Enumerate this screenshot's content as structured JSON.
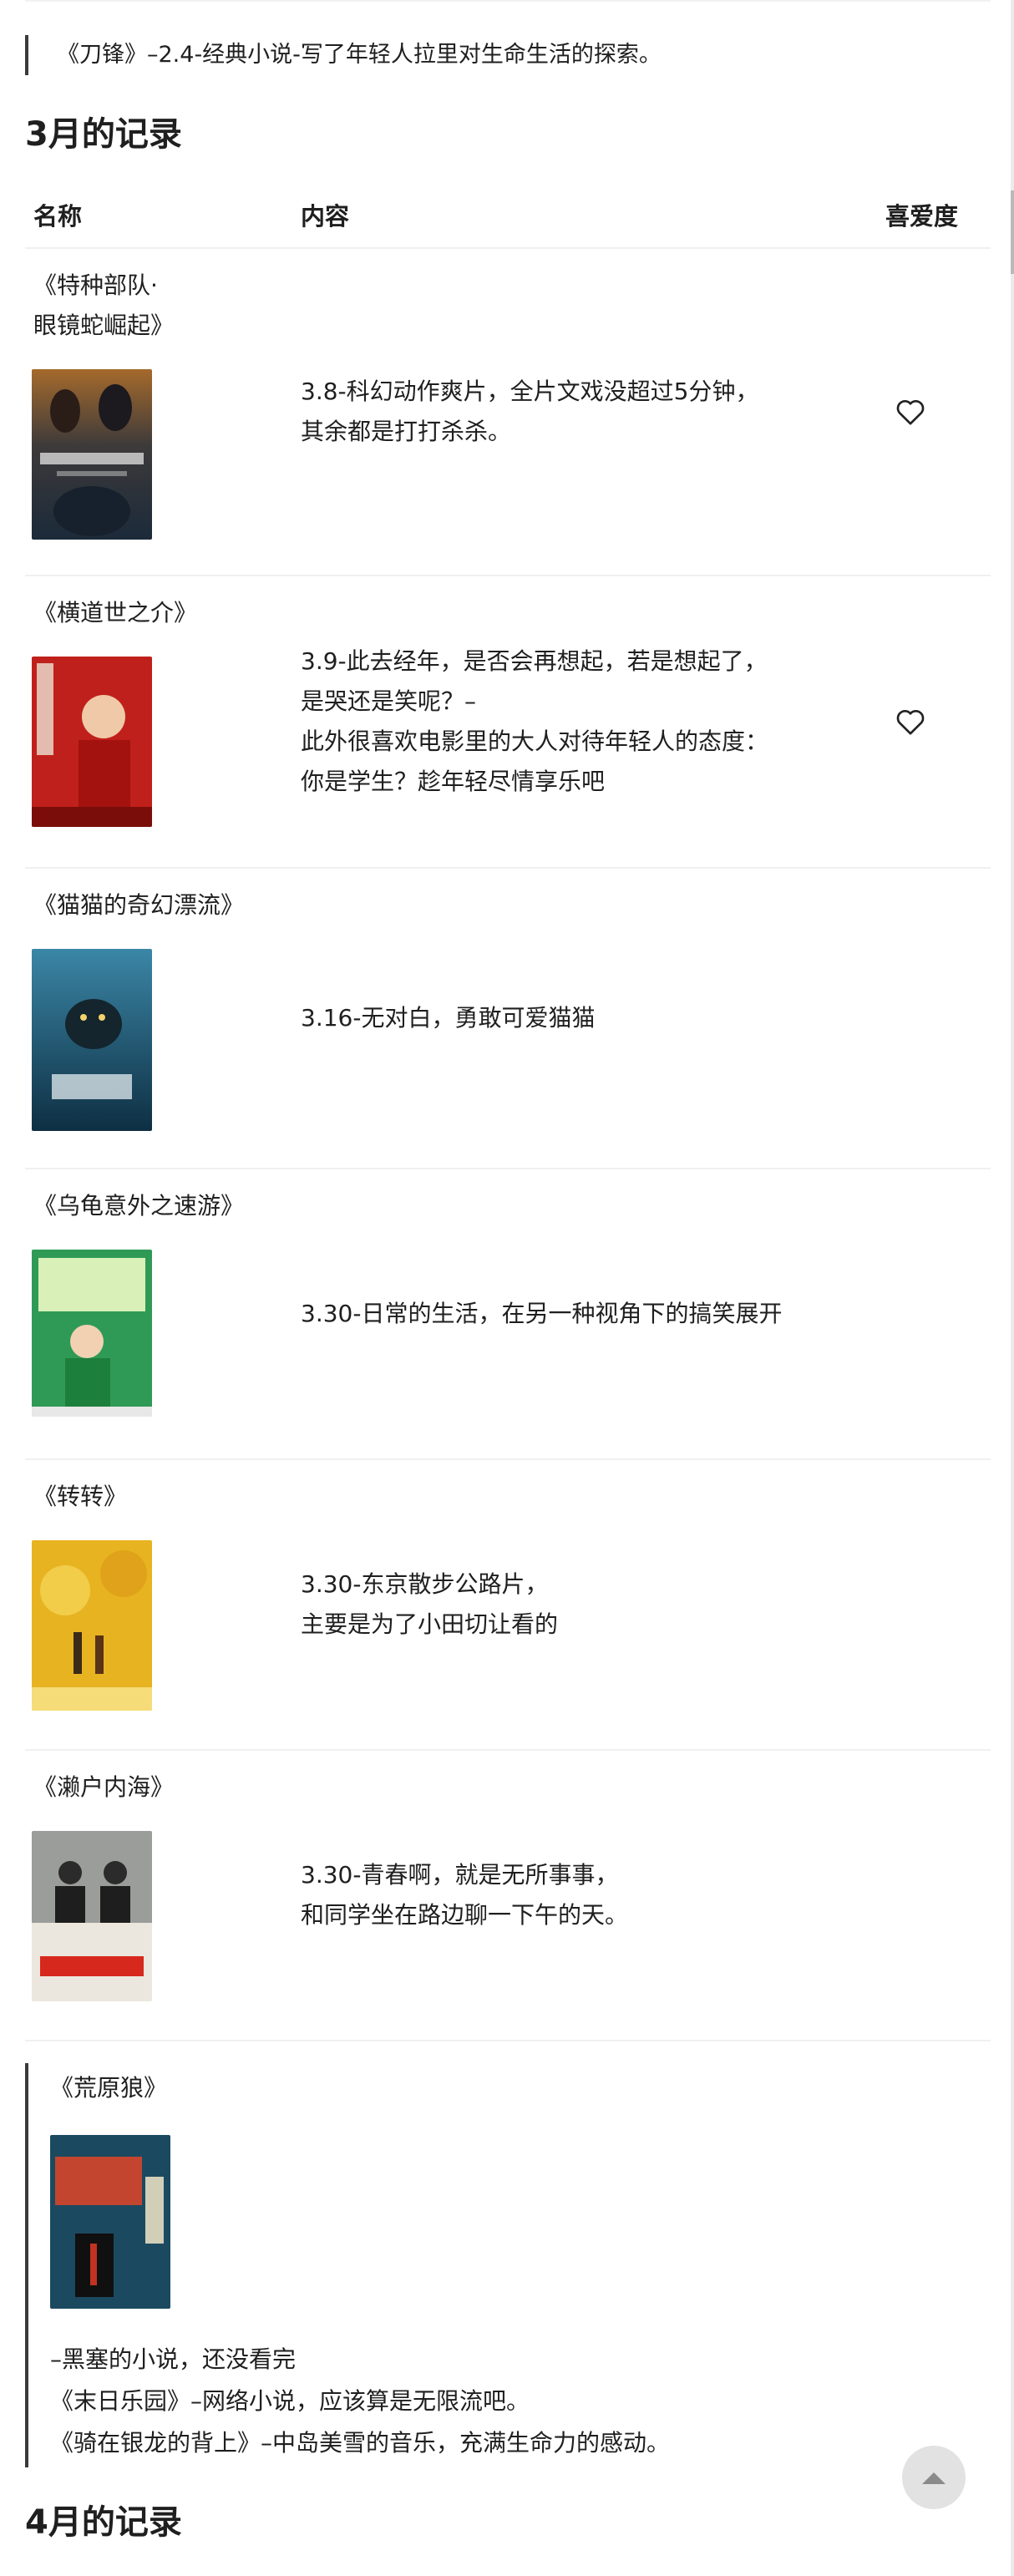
{
  "intro_quote": "《刀锋》–2.4-经典小说-写了年轻人拉里对生命生活的探索。",
  "march": {
    "title": "3月的记录",
    "headers": {
      "name": "名称",
      "content": "内容",
      "love": "喜爱度"
    },
    "rows": [
      {
        "name": "《特种部队·\n眼镜蛇崛起》",
        "content": "3.8-科幻动作爽片，全片文戏没超过5分钟，\n其余都是打打杀杀。",
        "loved": true
      },
      {
        "name": "《横道世之介》",
        "content": "3.9-此去经年，是否会再想起，若是想起了，\n是哭还是笑呢？–\n此外很喜欢电影里的大人对待年轻人的态度：\n你是学生？趁年轻尽情享乐吧",
        "loved": true
      },
      {
        "name": "《猫猫的奇幻漂流》",
        "content": "3.16-无对白，勇敢可爱猫猫",
        "loved": false
      },
      {
        "name": "《乌龟意外之速游》",
        "content": "3.30-日常的生活，在另一种视角下的搞笑展开",
        "loved": false
      },
      {
        "name": "《转转》",
        "content": "3.30-东京散步公路片，\n主要是为了小田切让看的",
        "loved": false
      },
      {
        "name": "《濑户内海》",
        "content": "3.30-青春啊，就是无所事事，\n和同学坐在路边聊一下午的天。",
        "loved": false
      }
    ]
  },
  "book_quote": {
    "title": "《荒原狼》",
    "lines": [
      "–黑塞的小说，还没看完",
      "《末日乐园》–网络小说，应该算是无限流吧。",
      "《骑在银龙的背上》–中岛美雪的音乐，充满生命力的感动。"
    ]
  },
  "april": {
    "title": "4月的记录"
  }
}
